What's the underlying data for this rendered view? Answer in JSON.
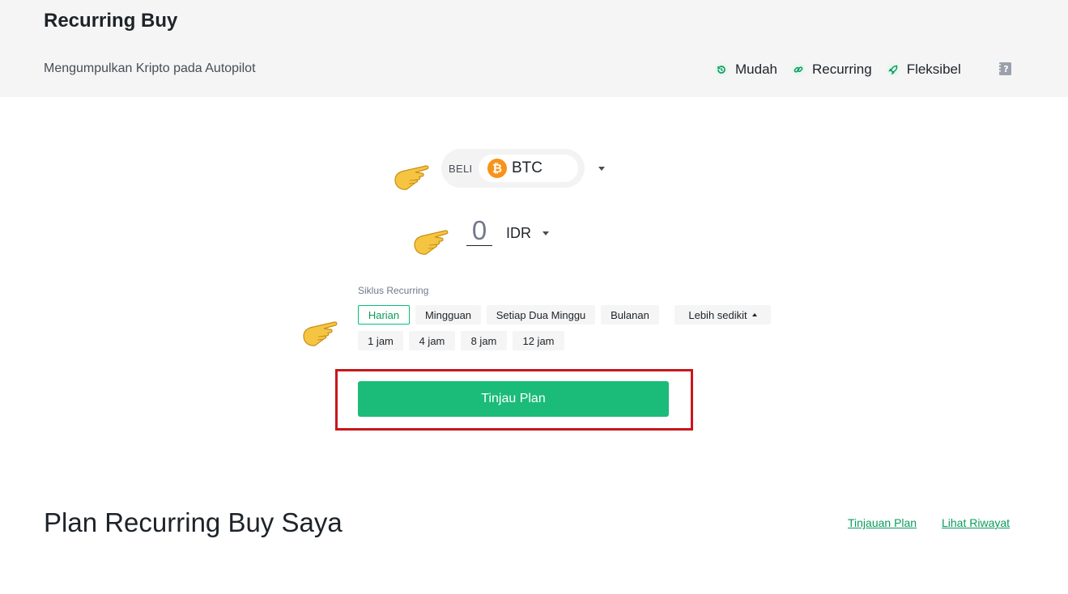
{
  "header": {
    "title": "Recurring Buy",
    "subtitle": "Mengumpulkan Kripto pada Autopilot",
    "features": [
      {
        "icon": "clock-icon",
        "label": "Mudah"
      },
      {
        "icon": "link-icon",
        "label": "Recurring"
      },
      {
        "icon": "rocket-icon",
        "label": "Fleksibel"
      }
    ],
    "help_icon": "help-book-icon"
  },
  "buy": {
    "label": "BELI",
    "coin": "BTC",
    "coin_icon": "bitcoin-icon"
  },
  "amount": {
    "value": "0",
    "currency": "IDR"
  },
  "cycle": {
    "label": "Siklus Recurring",
    "options": [
      "Harian",
      "Mingguan",
      "Setiap Dua Minggu",
      "Bulanan"
    ],
    "selected": "Harian",
    "less_toggle": "Lebih sedikit",
    "hour_options": [
      "1 jam",
      "4 jam",
      "8 jam",
      "12 jam"
    ]
  },
  "review_button": "Tinjau Plan",
  "plans": {
    "title": "Plan Recurring Buy Saya",
    "overview_link": "Tinjauan Plan",
    "history_link": "Lihat Riwayat"
  },
  "colors": {
    "accent_green": "#1bbb79",
    "active_chip_border": "#02c076",
    "highlight_red": "#c8171c",
    "header_bg": "#f5f5f5"
  }
}
